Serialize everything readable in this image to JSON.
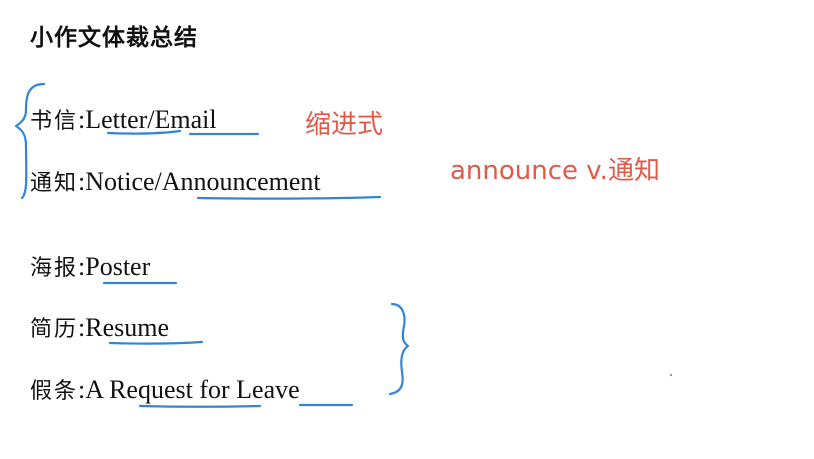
{
  "title": "小作文体裁总结",
  "rows": [
    {
      "cn": "书信",
      "en": ":Letter/Email"
    },
    {
      "cn": "通知",
      "en": ":Notice/Announcement"
    },
    {
      "cn": "海报",
      "en": ":Poster"
    },
    {
      "cn": "简历",
      "en": ":Resume"
    },
    {
      "cn": "假条",
      "en": ":A Request for Leave"
    }
  ],
  "notes": {
    "indent": "缩进式",
    "announce": "announce v.通知"
  },
  "colors": {
    "annotation_red": "#e05a4a",
    "pen_blue": "#2f86d8"
  }
}
